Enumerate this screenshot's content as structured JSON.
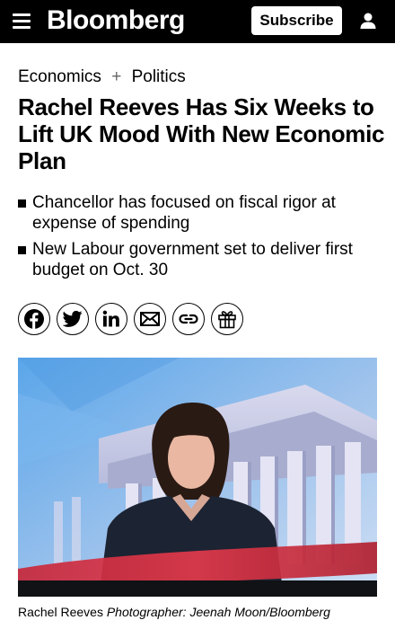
{
  "header": {
    "logo": "Bloomberg",
    "subscribe_label": "Subscribe",
    "icons": [
      "menu-icon",
      "user-icon"
    ]
  },
  "breadcrumb": {
    "section": "Economics",
    "separator": "+",
    "subsection": "Politics"
  },
  "article": {
    "headline": "Rachel Reeves Has Six Weeks to Lift UK Mood With New Economic Plan",
    "bullets": [
      "Chancellor has focused on fiscal rigor at expense of spending",
      "New Labour government set to deliver first budget on Oct. 30"
    ]
  },
  "share": {
    "icons": [
      "facebook-icon",
      "twitter-icon",
      "linkedin-icon",
      "email-icon",
      "link-icon",
      "gift-icon"
    ]
  },
  "photo": {
    "caption_subject": "Rachel Reeves",
    "caption_credit": "Photographer: Jeenah Moon/Bloomberg"
  },
  "colors": {
    "topbar": "#000000",
    "background": "#ffffff",
    "text": "#000000"
  }
}
